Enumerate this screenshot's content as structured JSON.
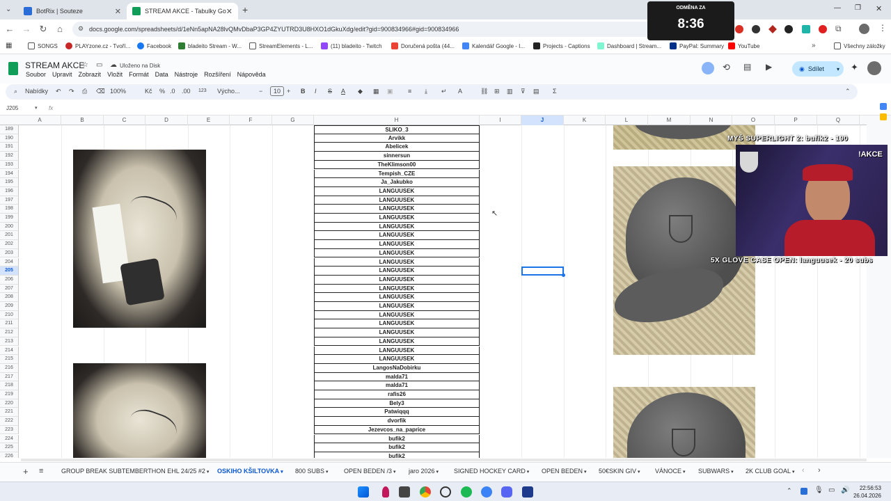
{
  "browser": {
    "tabs": [
      {
        "title": "BotRix | Souteze",
        "active": false
      },
      {
        "title": "STREAM AKCE - Tabulky Google",
        "active": true
      }
    ],
    "url": "docs.google.com/spreadsheets/d/1eNn5apNA28lvQMvDbaP3GP4ZYUTRD3U8HXO1dGkuXdg/edit?gid=900834966#gid=900834966",
    "bookmarks": [
      "SONGS",
      "PLAYzone.cz - Tvoří...",
      "Facebook",
      "bladeito Stream - W...",
      "StreamElements - L...",
      "(11) bladeito - Twitch",
      "Doručená pošta (44...",
      "Kalendář Google - I...",
      "Projects - Captions",
      "Dashboard | Stream...",
      "PayPal: Summary",
      "YouTube"
    ],
    "all_bookmarks": "Všechny záložky"
  },
  "sheets": {
    "title": "STREAM AKCE",
    "save_status": "Uloženo na Disk",
    "menu": [
      "Soubor",
      "Upravit",
      "Zobrazit",
      "Vložit",
      "Formát",
      "Data",
      "Nástroje",
      "Rozšíření",
      "Nápověda"
    ],
    "share": "Sdílet",
    "toolbar": {
      "search": "Nabídky",
      "zoom": "100%",
      "currency": "Kč",
      "percent": "%",
      "dec_less": ".0",
      "dec_more": ".00",
      "number_format": "123",
      "font": "Výcho...",
      "font_size": "10"
    },
    "name_box": "J205",
    "fx": "fx",
    "columns": [
      "A",
      "B",
      "C",
      "D",
      "E",
      "F",
      "G",
      "H",
      "I",
      "J",
      "K",
      "L",
      "M",
      "N",
      "O",
      "P",
      "Q"
    ],
    "selected_column": "J",
    "selected_row": "205",
    "rows": [
      {
        "n": "189",
        "h": "SLIKO_3"
      },
      {
        "n": "190",
        "h": "Arvikk"
      },
      {
        "n": "191",
        "h": "Abelicek"
      },
      {
        "n": "192",
        "h": "sinnersun"
      },
      {
        "n": "193",
        "h": "TheKlimson00"
      },
      {
        "n": "194",
        "h": "Tempish_CZE"
      },
      {
        "n": "195",
        "h": "Ja_Jakubko"
      },
      {
        "n": "196",
        "h": "LANGUUSEK"
      },
      {
        "n": "197",
        "h": "LANGUUSEK"
      },
      {
        "n": "198",
        "h": "LANGUUSEK"
      },
      {
        "n": "199",
        "h": "LANGUUSEK"
      },
      {
        "n": "200",
        "h": "LANGUUSEK"
      },
      {
        "n": "201",
        "h": "LANGUUSEK"
      },
      {
        "n": "202",
        "h": "LANGUUSEK"
      },
      {
        "n": "203",
        "h": "LANGUUSEK"
      },
      {
        "n": "204",
        "h": "LANGUUSEK"
      },
      {
        "n": "205",
        "h": "LANGUUSEK"
      },
      {
        "n": "206",
        "h": "LANGUUSEK"
      },
      {
        "n": "207",
        "h": "LANGUUSEK"
      },
      {
        "n": "208",
        "h": "LANGUUSEK"
      },
      {
        "n": "209",
        "h": "LANGUUSEK"
      },
      {
        "n": "210",
        "h": "LANGUUSEK"
      },
      {
        "n": "211",
        "h": "LANGUUSEK"
      },
      {
        "n": "212",
        "h": "LANGUUSEK"
      },
      {
        "n": "213",
        "h": "LANGUUSEK"
      },
      {
        "n": "214",
        "h": "LANGUUSEK"
      },
      {
        "n": "215",
        "h": "LANGUUSEK"
      },
      {
        "n": "216",
        "h": "LangosNaDobirku"
      },
      {
        "n": "217",
        "h": "malda71"
      },
      {
        "n": "218",
        "h": "malda71"
      },
      {
        "n": "219",
        "h": "rafis26"
      },
      {
        "n": "220",
        "h": "Bely3"
      },
      {
        "n": "221",
        "h": "Patwiqqq"
      },
      {
        "n": "222",
        "h": "dvorfik"
      },
      {
        "n": "223",
        "h": "Jezevcos_na_paprice"
      },
      {
        "n": "224",
        "h": "bufik2"
      },
      {
        "n": "225",
        "h": "bufik2"
      },
      {
        "n": "226",
        "h": "bufik2"
      }
    ],
    "sheet_tabs": [
      "GROUP BREAK SUBTEMBERTHON EHL 24/25 #2",
      "OSKIHO KŠILTOVKA",
      "800 SUBS",
      "OPEN BEDEN /3",
      "jaro 2026",
      "SIGNED HOCKEY CARD",
      "OPEN BEDEN",
      "50€SKIN GIV",
      "VÁNOCE",
      "SUBWARS",
      "2K CLUB GOAL"
    ],
    "active_sheet": "OSKIHO KŠILTOVKA"
  },
  "overlay": {
    "timer_label": "ODMĚNA ZA",
    "timer": "8:36",
    "ticker_top": "MYŠ SUPERLIGHT 2: bufik2 - 190",
    "ticker_bottom": "5X GLOVE CASE OPEN: languusek - 20 subs",
    "badge": "!AKCE"
  },
  "taskbar": {
    "time": "22:56:53",
    "date": "26.04.2026"
  },
  "colors": {
    "accent": "#1a73e8",
    "sheets_green": "#0f9d58",
    "share_bg": "#c2e7ff"
  }
}
